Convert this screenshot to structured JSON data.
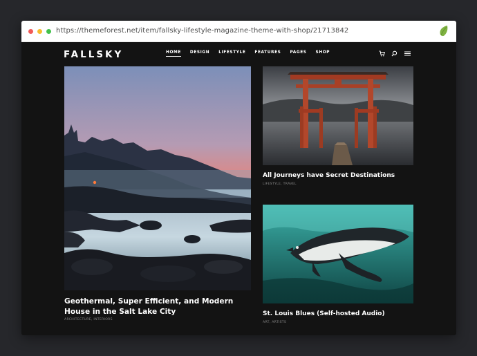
{
  "browser": {
    "url": "https://themeforest.net/item/fallsky-lifestyle-magazine-theme-with-shop/21713842",
    "accent_colors": {
      "close": "#f25a57",
      "minimize": "#f6be2f",
      "maximize": "#43c14c",
      "leaf": "#7fb241"
    },
    "extension_icon": "envato-leaf-icon"
  },
  "site": {
    "logo": "FALLSKY",
    "menu": [
      "HOME",
      "DESIGN",
      "LIFESTYLE",
      "FEATURES",
      "PAGES",
      "SHOP"
    ],
    "active_menu": "HOME",
    "icons": [
      "cart-icon",
      "search-icon",
      "hamburger-menu-icon"
    ]
  },
  "posts": {
    "hero": {
      "title": "Geothermal, Super Efficient, and Modern House in the Salt Lake City",
      "categories": "ARCHITECTURE, INTERIORS"
    },
    "card1": {
      "title": "All Journeys have Secret Destinations",
      "categories": "LIFESTYLE, TRAVEL"
    },
    "card2": {
      "title": "St. Louis Blues (Self-hosted Audio)",
      "categories": "ART, ARTISTS"
    }
  }
}
